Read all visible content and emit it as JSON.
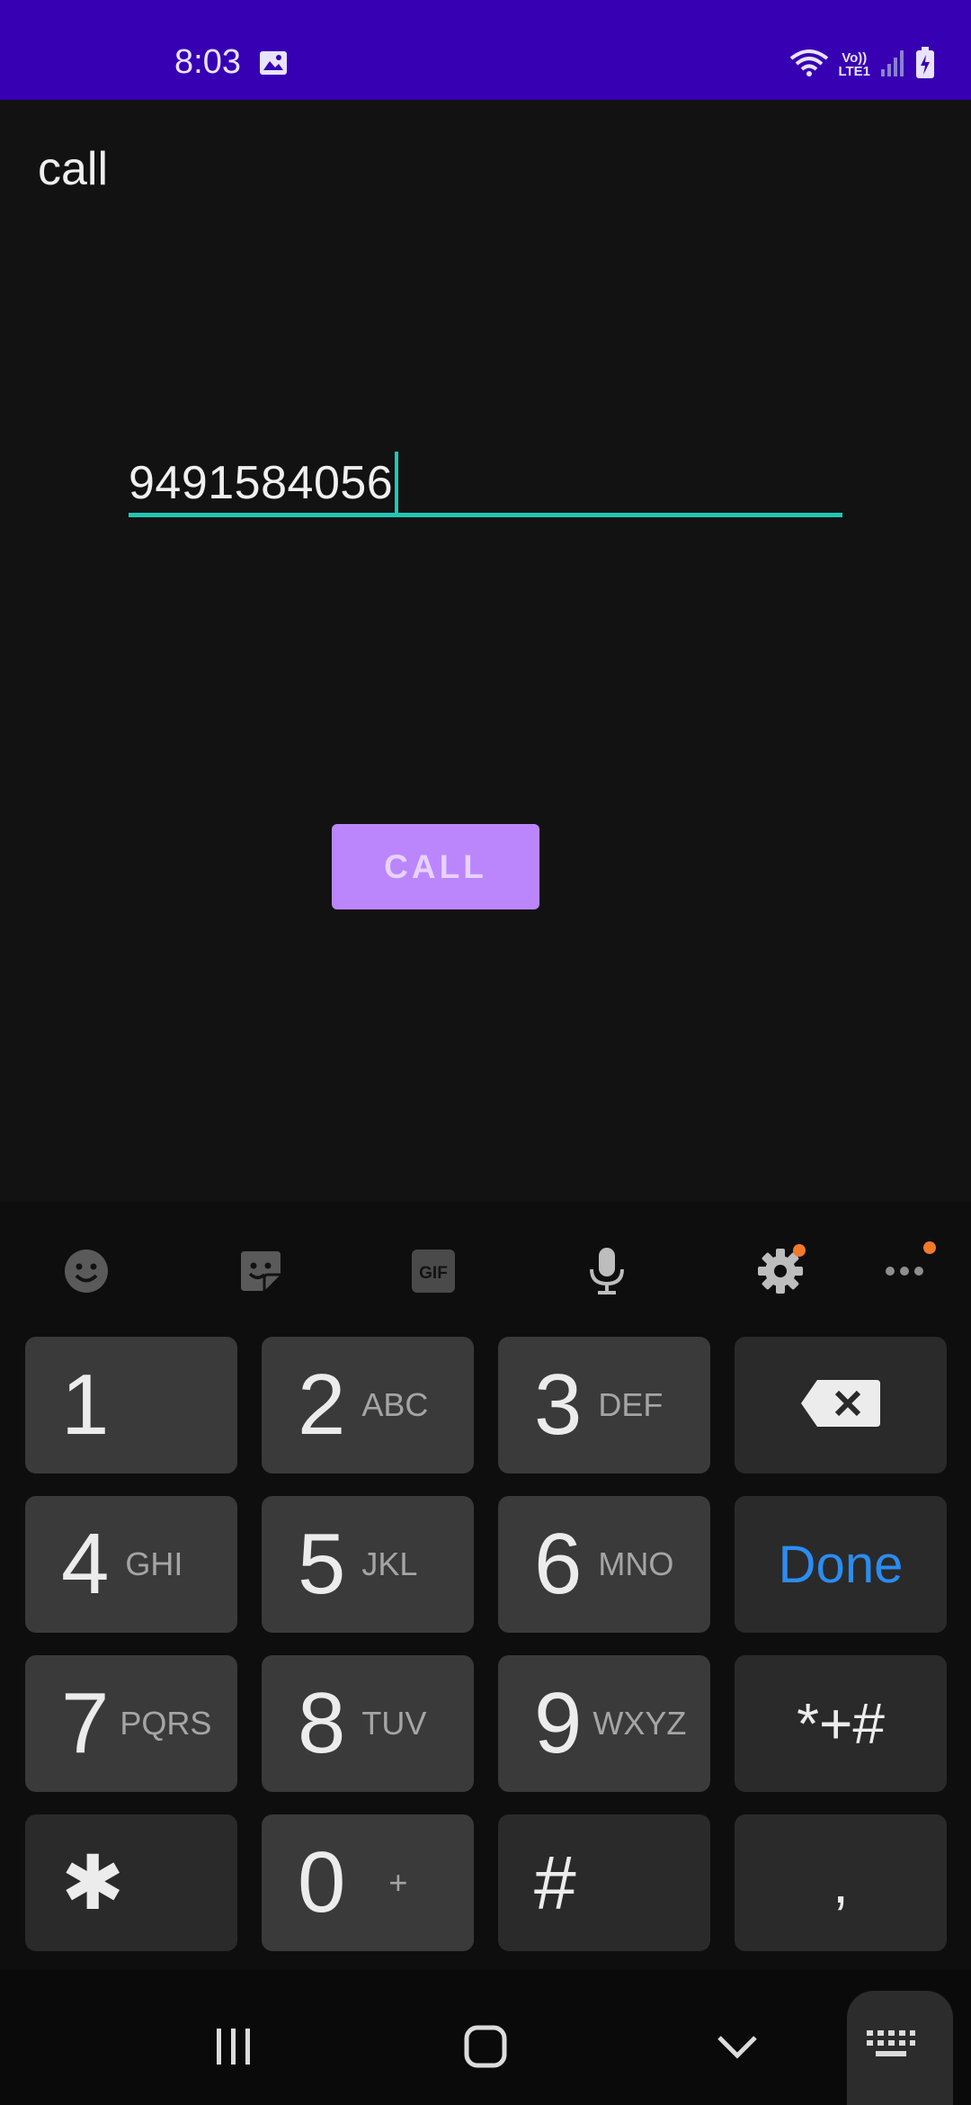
{
  "status_bar": {
    "time": "8:03",
    "network_label": "Vo))\nLTE1",
    "icons": [
      "image-icon",
      "wifi-icon",
      "volte-icon",
      "signal-icon",
      "battery-charging-icon"
    ]
  },
  "app": {
    "title": "call",
    "phone_value": "9491584056",
    "call_button": "CALL"
  },
  "keyboard": {
    "toolbar": [
      "emoji-icon",
      "sticker-icon",
      "gif-icon",
      "microphone-icon",
      "settings-icon",
      "more-icon"
    ],
    "gif_label": "GIF",
    "keys": {
      "k1": {
        "num": "1",
        "sub": ""
      },
      "k2": {
        "num": "2",
        "sub": "ABC"
      },
      "k3": {
        "num": "3",
        "sub": "DEF"
      },
      "k4": {
        "num": "4",
        "sub": "GHI"
      },
      "k5": {
        "num": "5",
        "sub": "JKL"
      },
      "k6": {
        "num": "6",
        "sub": "MNO"
      },
      "k7": {
        "num": "7",
        "sub": "PQRS"
      },
      "k8": {
        "num": "8",
        "sub": "TUV"
      },
      "k9": {
        "num": "9",
        "sub": "WXYZ"
      },
      "k0": {
        "num": "0",
        "sub": "+"
      },
      "star": "✱",
      "hash": "#",
      "comma": ",",
      "symbols": "*+#",
      "done": "Done"
    }
  },
  "colors": {
    "status_bar": "#3700b3",
    "accent_teal": "#1fc7b6",
    "button_purple": "#bb86fc",
    "done_blue": "#2c8cf0",
    "notification_dot": "#f07a2a"
  }
}
